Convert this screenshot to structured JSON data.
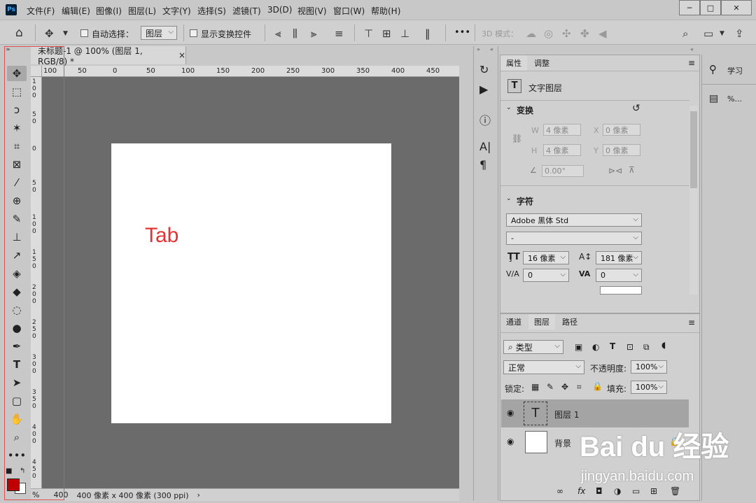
{
  "app": {
    "logo": "Ps"
  },
  "menu": [
    "文件(F)",
    "编辑(E)",
    "图像(I)",
    "图层(L)",
    "文字(Y)",
    "选择(S)",
    "滤镜(T)",
    "3D(D)",
    "视图(V)",
    "窗口(W)",
    "帮助(H)"
  ],
  "window_controls": {
    "minimize": "─",
    "maximize": "□",
    "close": "✕"
  },
  "options": {
    "auto_select_label": "自动选择：",
    "auto_select_value": "图层",
    "show_transform_label": "显示变换控件",
    "more": "•••",
    "mode_3d_label": "3D 模式："
  },
  "document": {
    "tab_title": "未标题-1 @ 100% (图层 1, RGB/8) *",
    "close": "×",
    "annotation": "Tab",
    "zoom": "400",
    "percent_suffix": "%",
    "status_info": "400 像素 x 400 像素 (300 ppi)",
    "status_arrow": "›"
  },
  "ruler_h": [
    "100",
    "50",
    "0",
    "50",
    "100",
    "150",
    "200",
    "250",
    "300",
    "350",
    "400",
    "450"
  ],
  "ruler_v": [
    "1 0 0",
    "5 0",
    "0",
    "5 0",
    "1 0 0",
    "1 5 0",
    "2 0 0",
    "2 5 0",
    "3 0 0",
    "3 5 0",
    "4 0 0",
    "4 5 0"
  ],
  "properties": {
    "tabs": [
      "属性",
      "调整"
    ],
    "layer_type": "文字图层",
    "transform_title": "变换",
    "w_label": "W",
    "w_value": "4 像素",
    "h_label": "H",
    "h_value": "4 像素",
    "x_label": "X",
    "x_value": "0 像素",
    "y_label": "Y",
    "y_value": "0 像素",
    "angle_value": "0.00°",
    "character_title": "字符",
    "font_family": "Adobe 黑体 Std",
    "font_style": "-",
    "font_size": "16 像素",
    "leading": "181 像素",
    "kerning": "0",
    "tracking": "0"
  },
  "layers_panel": {
    "tabs": [
      "通道",
      "图层",
      "路径"
    ],
    "filter_label": "类型",
    "blend_mode": "正常",
    "opacity_label": "不透明度:",
    "opacity_value": "100%",
    "lock_label": "锁定:",
    "fill_label": "填充:",
    "fill_value": "100%",
    "layers": [
      {
        "name": "图层 1",
        "type": "text"
      },
      {
        "name": "背景",
        "type": "background"
      }
    ],
    "bottom_icons": [
      "link-icon",
      "fx-icon",
      "mask-icon",
      "adjustment-icon",
      "group-icon",
      "new-layer-icon",
      "trash-icon"
    ]
  },
  "right_panel": {
    "learn": "学习",
    "libraries": "%..."
  },
  "colors": {
    "foreground": "#c00000",
    "background": "#ffffff",
    "annotation": "#e53333"
  },
  "watermark": {
    "brand": "Bai du 经验",
    "url": "jingyan.baidu.com"
  }
}
